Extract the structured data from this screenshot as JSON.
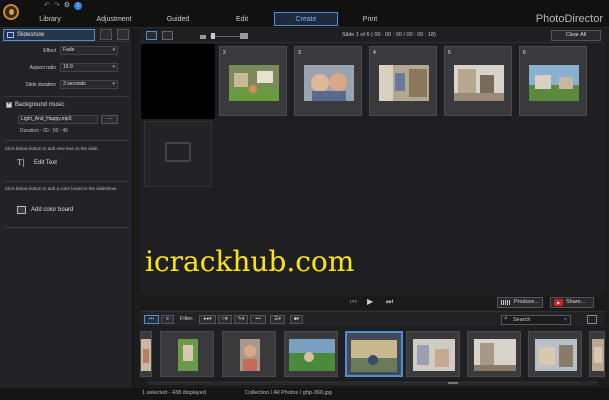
{
  "app": {
    "brand": "PhotoDirector",
    "tabs": [
      "Library",
      "Adjustment",
      "Guided",
      "Edit",
      "Create",
      "Print"
    ],
    "active_tab": "Create"
  },
  "left_panel": {
    "tab_label": "Slideshow",
    "effect_label": "Effect",
    "effect_value": "Fade",
    "aspect_label": "Aspect ratio",
    "aspect_value": "16:9",
    "slide_duration_label": "Slide duration",
    "slide_duration_value": "3 seconds",
    "background_music_label": "Background music",
    "music_file": "Light_And_Happy.mp3",
    "browse_label": "...",
    "duration_text": "Duration : 00 : 00 : 45",
    "text_note": "Click below button to add new text on the slide.",
    "edit_text_label": "Edit Text",
    "board_note": "Click below button to add a color board in the slideshow.",
    "add_board_label": "Add color board"
  },
  "slide_bar": {
    "slide_info": "Slide   1   of   6 ( 00 : 00 : 00 / 00 : 00 : 18)",
    "clear_all": "Clear All"
  },
  "storyboard": {
    "slides": [
      "2",
      "3",
      "4",
      "5",
      "6"
    ]
  },
  "watermark": "icrackhub.com",
  "playback": {
    "produce_label": "Produce...",
    "share_label": "Share..."
  },
  "library": {
    "filter_label": "Filter:",
    "search_placeholder": "Search",
    "search_clear": "×"
  },
  "status": {
    "selection": "1 selected - 438 displayed",
    "path": "Collection / All Photos / ghp-360.jpg"
  }
}
